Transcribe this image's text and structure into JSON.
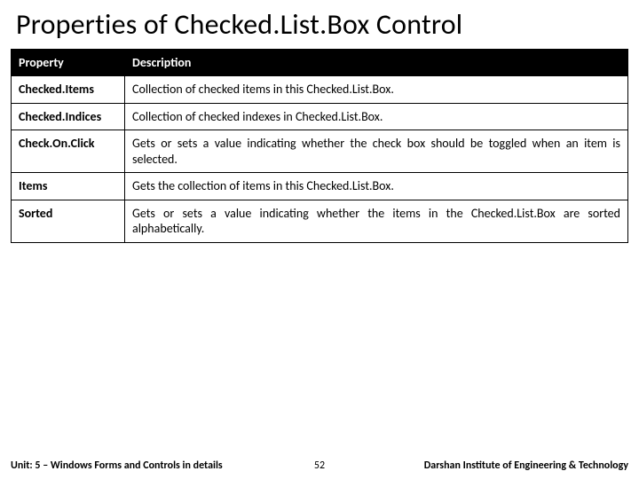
{
  "title": "Properties of Checked.List.Box Control",
  "table": {
    "headers": {
      "property": "Property",
      "description": "Description"
    },
    "rows": [
      {
        "property": "Checked.Items",
        "description": "Collection of checked items in this Checked.List.Box."
      },
      {
        "property": "Checked.Indices",
        "description": "Collection of checked indexes in Checked.List.Box."
      },
      {
        "property": "Check.On.Click",
        "description": "Gets or sets a value indicating whether the check box should be toggled when an item is selected."
      },
      {
        "property": "Items",
        "description": "Gets the collection of items in this Checked.List.Box."
      },
      {
        "property": "Sorted",
        "description": "Gets or sets a value indicating whether the items in the Checked.List.Box are sorted alphabetically."
      }
    ]
  },
  "footer": {
    "left": "Unit: 5 – Windows Forms and Controls in details",
    "center": "52",
    "right": "Darshan Institute of Engineering & Technology"
  }
}
